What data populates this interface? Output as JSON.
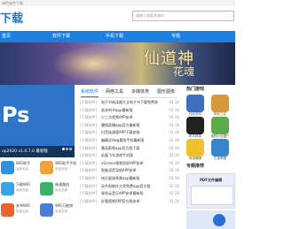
{
  "top_bar": {
    "text": "绿色软件下载"
  },
  "header": {
    "logo": "下载",
    "search_placeholder": "请输入搜索关键词"
  },
  "nav": {
    "items": [
      "首页",
      "软件下载",
      "手机下载",
      "专题"
    ]
  },
  "banner": {
    "art_text": "仙道神",
    "art_text2": "花魂"
  },
  "slider": {
    "logo_text": "Ps",
    "caption": "op2020 v1.0.7.0 最新版"
  },
  "tabs": [
    "系统软件",
    "网络工具",
    "多媒体类",
    "图形图像"
  ],
  "news": [
    {
      "cat": "[下载软件]",
      "title": "电子书阅读器大全电子书下载免费软件",
      "date": "02-16"
    },
    {
      "cat": "[下载软件]",
      "title": "若米听书app最新版",
      "date": "02-16"
    },
    {
      "cat": "[下载软件]",
      "title": "小三点视频APP安卓",
      "date": "02-16"
    },
    {
      "cat": "[下载软件]",
      "title": "魔镜直播app官方最新版",
      "date": "02-16"
    },
    {
      "cat": "[下载软件]",
      "title": "抖音极速版APP下载安装",
      "date": "02-16"
    },
    {
      "cat": "[下载软件]",
      "title": "幽精灵dwg看图手机最新版",
      "date": "02-16"
    },
    {
      "cat": "[下载软件]",
      "title": "番茄影视app官方版下载",
      "date": "02-16"
    },
    {
      "cat": "[下载软件]",
      "title": "彩蛋飞车游戏手机版",
      "date": "02-16"
    },
    {
      "cat": "[下载软件]",
      "title": "vScreen视频投屏APP安卓",
      "date": "02-16"
    },
    {
      "cat": "[下载软件]",
      "title": "智能语音导航APP安卓",
      "date": "02-16"
    },
    {
      "cat": "[下载软件]",
      "title": "快乐星球视频app最新版",
      "date": "02-16"
    },
    {
      "cat": "[下载软件]",
      "title": "证件照制作大师免费app官方版",
      "date": "02-16"
    },
    {
      "cat": "[下载软件]",
      "title": "咪咕云音乐APP安卓最新版",
      "date": "02-16"
    },
    {
      "cat": "[下载软件]",
      "title": "好看视频APP官方版安卓",
      "date": "02-16"
    }
  ],
  "hot": {
    "title": "热门游戏",
    "items": [
      {
        "name": "仙剑游戏",
        "color": "#3d6fbf"
      },
      {
        "name": "明日之后",
        "color": "#d69a3a"
      },
      {
        "name": "和平精英",
        "color": "#222222"
      },
      {
        "name": "植物大战僵尸",
        "color": "#5bab4a"
      },
      {
        "name": "奇迹暖暖",
        "color": "#f0c12c"
      },
      {
        "name": "王者荣耀",
        "color": "#3a84c9"
      }
    ]
  },
  "recommend": {
    "title": "专题推荐",
    "card_title": "PDF文件编辑"
  },
  "soft_list": [
    {
      "name": "WiFi助手",
      "status": "免费安装",
      "color": "#2f8fe0"
    },
    {
      "name": "WiFi助手手机",
      "status": "免费安装",
      "color": "#f2a23a"
    },
    {
      "name": "万能WiFi",
      "status": "免费安装",
      "color": "#37a4e8"
    },
    {
      "name": "极速路由",
      "status": "免费安装",
      "color": "#3ab06a"
    },
    {
      "name": "安卓WiFi",
      "status": "免费安装",
      "color": "#e9622f"
    },
    {
      "name": "WiFi万能钥",
      "status": "免费安装",
      "color": "#4a7dd8"
    }
  ],
  "colors": {
    "brand": "#1f7fe0"
  }
}
